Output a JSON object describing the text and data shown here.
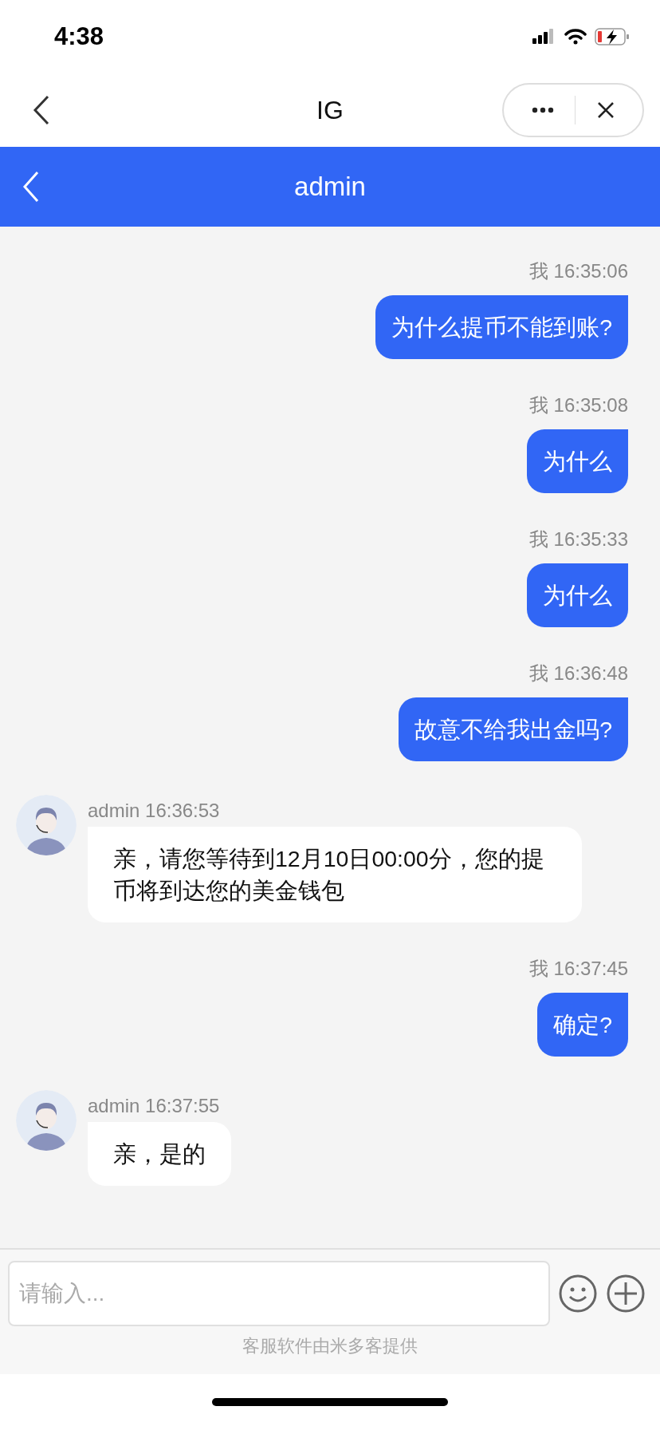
{
  "status_bar": {
    "time": "4:38"
  },
  "nav_bar": {
    "title": "IG"
  },
  "chat_header": {
    "title": "admin"
  },
  "messages": [
    {
      "kind": "self",
      "meta": "我 16:35:06",
      "text": "为什么提币不能到账?"
    },
    {
      "kind": "self",
      "meta": "我 16:35:08",
      "text": "为什么"
    },
    {
      "kind": "self",
      "meta": "我 16:35:33",
      "text": "为什么"
    },
    {
      "kind": "self",
      "meta": "我 16:36:48",
      "text": "故意不给我出金吗?"
    },
    {
      "kind": "agent",
      "meta": "admin 16:36:53",
      "text": "亲，请您等待到12月10日00:00分，您的提币将到达您的美金钱包"
    },
    {
      "kind": "self",
      "meta": "我 16:37:45",
      "text": "确定?"
    },
    {
      "kind": "agent",
      "meta": "admin 16:37:55",
      "text": "亲，是的"
    }
  ],
  "composer": {
    "placeholder": "请输入...",
    "footer": "客服软件由米多客提供"
  }
}
